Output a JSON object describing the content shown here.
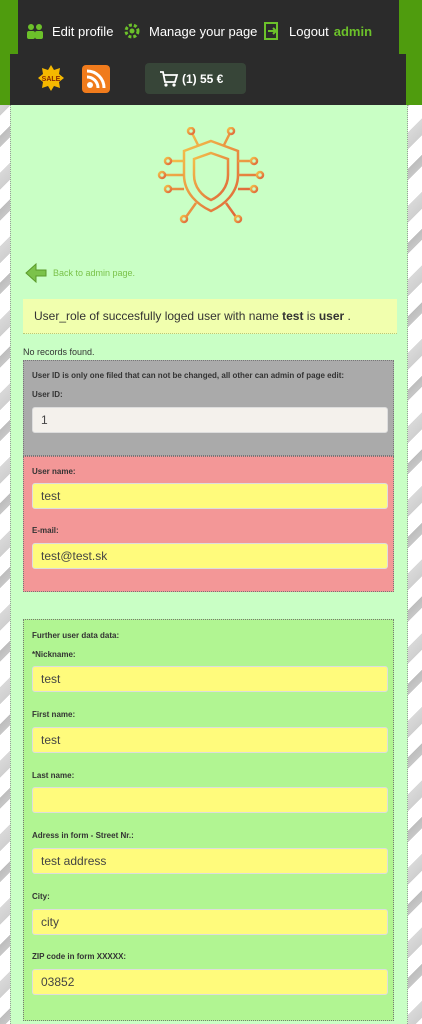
{
  "header": {
    "edit_profile": "Edit profile",
    "manage_page": "Manage your page",
    "logout": "Logout",
    "username": "admin",
    "cart_label": "(1) 55 €",
    "sale_badge": "SALE"
  },
  "back_link": "Back to admin page.",
  "info_message": {
    "prefix": "User_role of succesfully loged user with name ",
    "name": "test",
    "middle": " is ",
    "role": "user",
    "suffix": " ."
  },
  "no_records": "No records found.",
  "grey_box": {
    "note": "User ID is only one filed that can not be changed, all other can admin of page edit:",
    "user_id_label": "User ID:",
    "user_id_value": "1"
  },
  "red_box": {
    "username_label": "User name:",
    "username_value": "test",
    "email_label": "E-mail:",
    "email_value": "test@test.sk"
  },
  "green_box": {
    "heading": "Further user data data:",
    "nickname_label": "*Nickname:",
    "nickname_value": "test",
    "first_name_label": "First name:",
    "first_name_value": "test",
    "last_name_label": "Last name:",
    "last_name_value": "",
    "address_label": "Adress in form - Street Nr.:",
    "address_value": "test address",
    "city_label": "City:",
    "city_value": "city",
    "zip_label": "ZIP code in form XXXXX:",
    "zip_value": "03852"
  },
  "colors": {
    "accent": "#6cc12a",
    "brand_green": "#4f9c0e",
    "page_bg": "#c9ffc5",
    "info_bg": "#f1ffae",
    "field_yellow": "#fffb7c",
    "box_red": "#f39797",
    "box_grey": "#aaaaaa",
    "box_green": "#b1f592"
  },
  "icons": [
    "users-icon",
    "gear-icon",
    "logout-icon",
    "sale-badge-icon",
    "rss-icon",
    "cart-icon",
    "chip-shield-icon",
    "back-arrow-icon"
  ]
}
